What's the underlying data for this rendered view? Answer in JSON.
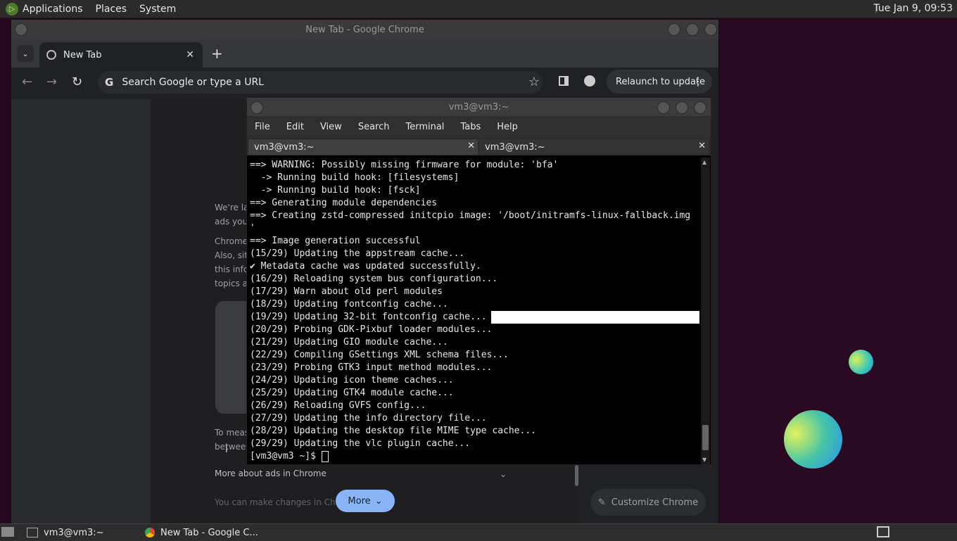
{
  "top_panel": {
    "logo_glyph": "▷",
    "menus": [
      "Applications",
      "Places",
      "System"
    ],
    "clock": "Tue Jan  9, 09:53"
  },
  "chrome": {
    "window_title": "New Tab - Google Chrome",
    "tab_label": "New Tab",
    "close_glyph": "✕",
    "new_tab_glyph": "+",
    "dropdown_glyph": "⌄",
    "back_glyph": "←",
    "forward_glyph": "→",
    "reload_glyph": "↻",
    "omnibox_g": "G",
    "omnibox_placeholder": "Search Google or type a URL",
    "star_glyph": "☆",
    "relaunch_label": "Relaunch to update",
    "menu_glyph": "⋮",
    "content_lines": [
      "We're la",
      "ads you",
      "Chrome",
      "Also, sit",
      "this info",
      "topics a",
      "To meas",
      "betweer"
    ],
    "more_about_ads": "More about ads in Chrome",
    "chevron_glyph": "⌄",
    "you_can_make": "You can make changes in Chr",
    "more_button": "More",
    "more_chevron": "⌄",
    "customize_label": "Customize Chrome",
    "pencil_glyph": "✎"
  },
  "terminal": {
    "title": "vm3@vm3:~",
    "menus": [
      "File",
      "Edit",
      "View",
      "Search",
      "Terminal",
      "Tabs",
      "Help"
    ],
    "tabs": [
      "vm3@vm3:~",
      "vm3@vm3:~"
    ],
    "close_glyph": "✕",
    "scroll_up": "▲",
    "scroll_down": "▼",
    "lines": [
      "==> WARNING: Possibly missing firmware for module: 'bfa'",
      "  -> Running build hook: [filesystems]",
      "  -> Running build hook: [fsck]",
      "==> Generating module dependencies",
      "==> Creating zstd-compressed initcpio image: '/boot/initramfs-linux-fallback.img",
      "'",
      "==> Image generation successful",
      "(15/29) Updating the appstream cache...",
      "✔ Metadata cache was updated successfully.",
      "(16/29) Reloading system bus configuration...",
      "(17/29) Warn about old perl modules",
      "(18/29) Updating fontconfig cache...",
      "(19/29) Updating 32-bit fontconfig cache...",
      "(20/29) Probing GDK-Pixbuf loader modules...",
      "(21/29) Updating GIO module cache...",
      "(22/29) Compiling GSettings XML schema files...",
      "(23/29) Probing GTK3 input method modules...",
      "(24/29) Updating icon theme caches...",
      "(25/29) Updating GTK4 module cache...",
      "(26/29) Reloading GVFS config...",
      "(27/29) Updating the info directory file...",
      "(28/29) Updating the desktop file MIME type cache...",
      "(29/29) Updating the vlc plugin cache..."
    ],
    "prompt": "[vm3@vm3 ~]$ "
  },
  "taskbar": {
    "items": [
      "vm3@vm3:~",
      "New Tab - Google C..."
    ]
  }
}
